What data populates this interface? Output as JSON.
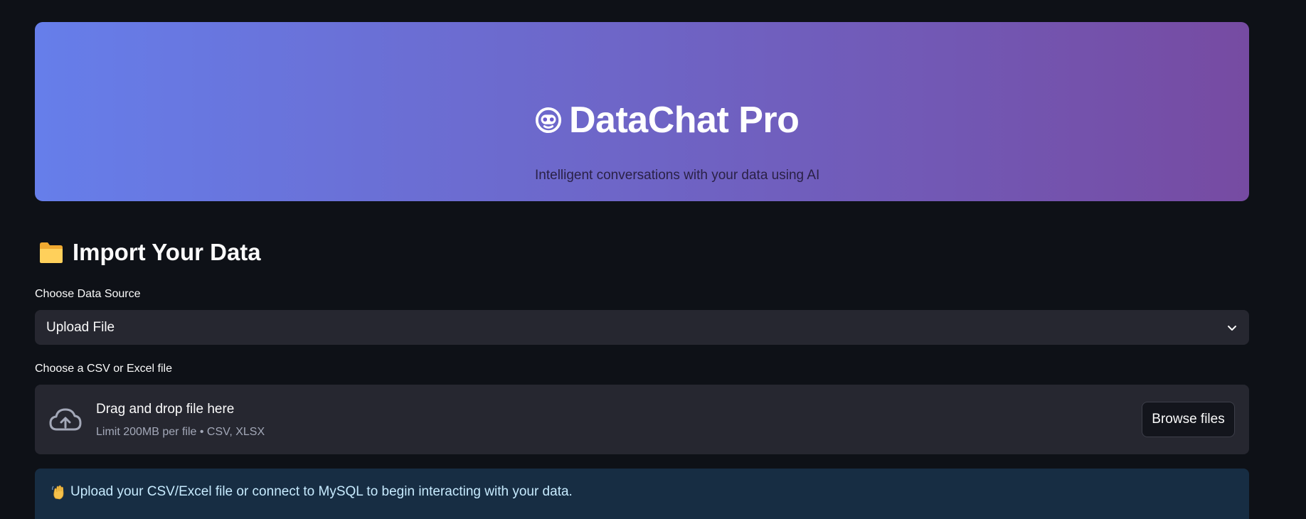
{
  "hero": {
    "title": "DataChat Pro",
    "subtitle": "Intelligent conversations with your data using AI",
    "gradient_start": "#667eea",
    "gradient_end": "#764ba2",
    "icon": "robot-icon"
  },
  "import_section": {
    "title": "Import Your Data",
    "icon": "folder-icon",
    "source_label": "Choose Data Source",
    "source_selected": "Upload File",
    "file_label": "Choose a CSV or Excel file"
  },
  "uploader": {
    "title": "Drag and drop file here",
    "hint": "Limit 200MB per file • CSV, XLSX",
    "browse_label": "Browse files",
    "icon": "cloud-upload-icon"
  },
  "info": {
    "icon": "waving-hand-icon",
    "message": "Upload your CSV/Excel file or connect to MySQL to begin interacting with your data."
  }
}
